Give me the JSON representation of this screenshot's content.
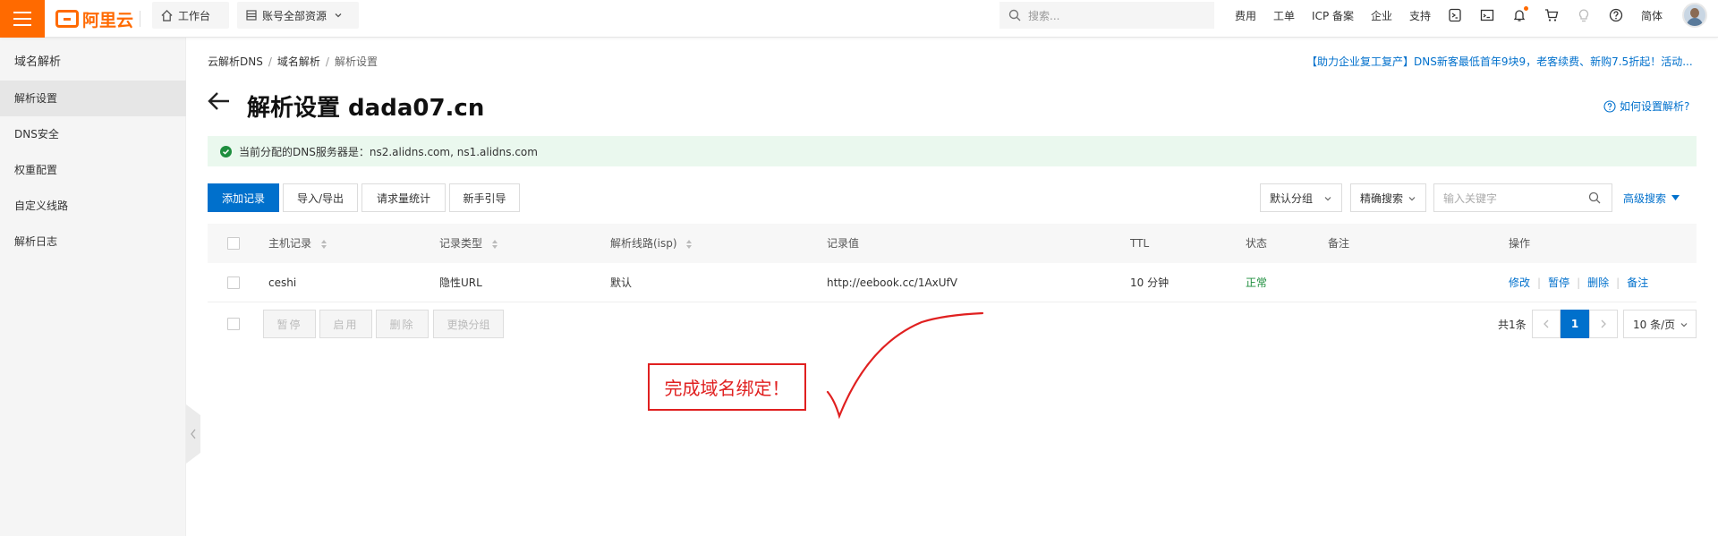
{
  "topbar": {
    "logo_text": "阿里云",
    "workbench": "工作台",
    "resources": "账号全部资源",
    "search_placeholder": "搜索...",
    "links": [
      "费用",
      "工单",
      "ICP 备案",
      "企业",
      "支持"
    ],
    "lang": "简体"
  },
  "sidebar": {
    "title": "域名解析",
    "items": [
      "解析设置",
      "DNS安全",
      "权重配置",
      "自定义线路",
      "解析日志"
    ]
  },
  "breadcrumb": [
    "云解析DNS",
    "域名解析",
    "解析设置"
  ],
  "promo": "【助力企业复工复产】DNS新客最低首年9块9，老客续费、新购7.5折起！活动...",
  "page": {
    "title": "解析设置 dada07.cn",
    "help": "如何设置解析?"
  },
  "alert": {
    "text": "当前分配的DNS服务器是：ns2.alidns.com, ns1.alidns.com"
  },
  "toolbar": {
    "add": "添加记录",
    "import_export": "导入/导出",
    "req_stats": "请求量统计",
    "guide": "新手引导",
    "group": "默认分组",
    "search_mode": "精确搜索",
    "keyword_placeholder": "输入关键字",
    "advanced": "高级搜索"
  },
  "table": {
    "headers": [
      "主机记录",
      "记录类型",
      "解析线路(isp)",
      "记录值",
      "TTL",
      "状态",
      "备注",
      "操作"
    ],
    "rows": [
      {
        "host": "ceshi",
        "type": "隐性URL",
        "line": "默认",
        "value": "http://eebook.cc/1AxUfV",
        "ttl": "10 分钟",
        "status": "正常",
        "note": "",
        "ops": [
          "修改",
          "暂停",
          "删除",
          "备注"
        ]
      }
    ]
  },
  "footer": {
    "pause": "暂停",
    "enable": "启用",
    "delete": "删除",
    "change_group": "更换分组",
    "total": "共1条",
    "current_page": "1",
    "page_size": "10 条/页"
  },
  "annotation": {
    "text": "完成域名绑定！",
    "color": "#e02020"
  },
  "colors": {
    "brand": "#ff6a00",
    "primary": "#0070cc",
    "success": "#1e8e3e",
    "alert_bg": "#eaf8ee"
  }
}
